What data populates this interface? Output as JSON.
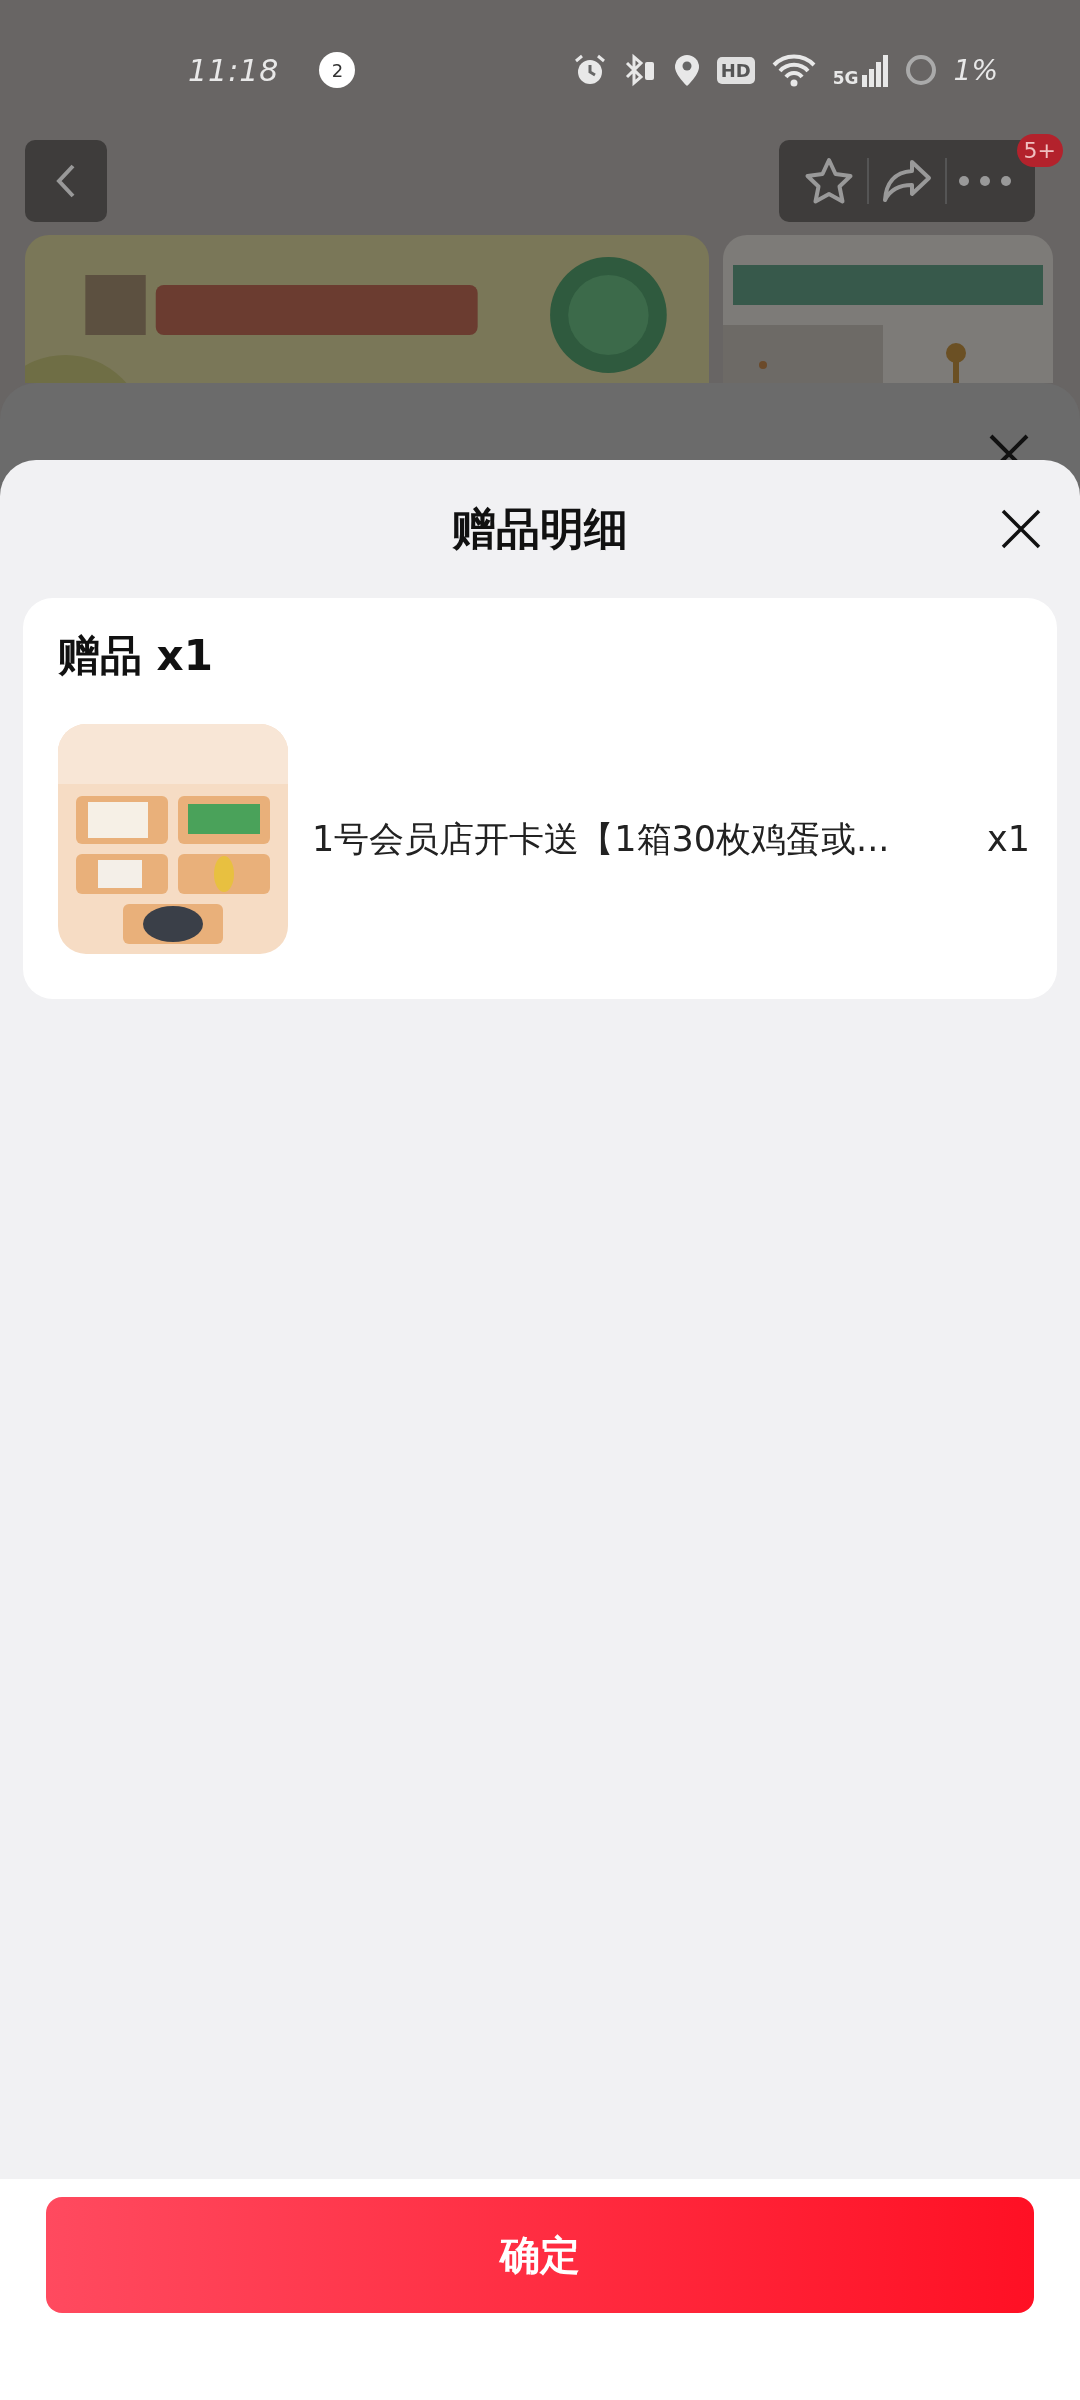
{
  "status_bar": {
    "time": "11:18",
    "notification_count": "2",
    "hd_label": "HD",
    "network_label": "5G",
    "battery": "1%"
  },
  "nav": {
    "more_badge": "5+"
  },
  "sheet": {
    "title": "赠品明细",
    "section_title": "赠品 x1",
    "gifts": [
      {
        "name": "1号会员店开卡送【1箱30枚鸡蛋或...",
        "quantity": "x1"
      }
    ]
  },
  "confirm_button": "确定"
}
